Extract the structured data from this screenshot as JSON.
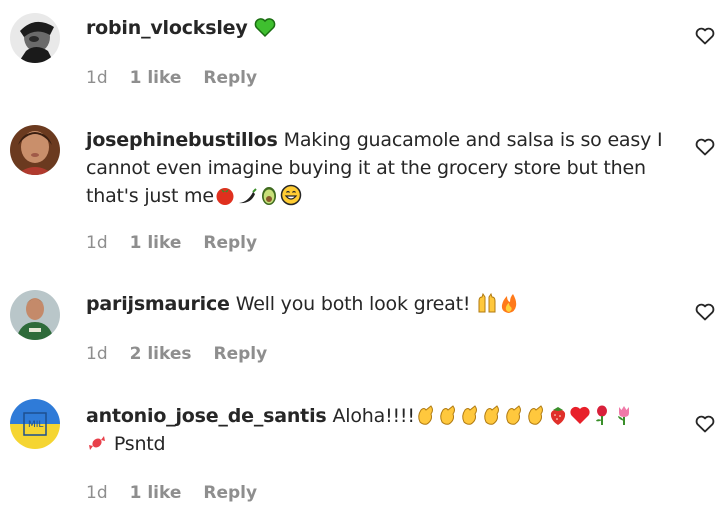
{
  "comments": [
    {
      "username": "robin_vlocksley",
      "text": "",
      "emojis": [
        "green-heart"
      ],
      "time": "1d",
      "likes": "1 like",
      "reply": "Reply",
      "avatar": "dark-portrait"
    },
    {
      "username": "josephinebustillos",
      "text": "Making guacamole and salsa is so easy I cannot even imagine buying it at the grocery store but then that's just me",
      "emojis": [
        "tomato",
        "hot-pepper",
        "avocado",
        "grinning-face"
      ],
      "time": "1d",
      "likes": "1 like",
      "reply": "Reply",
      "avatar": "woman-portrait"
    },
    {
      "username": "parijsmaurice",
      "text": "Well you both look great!",
      "emojis": [
        "raising-hands",
        "fire"
      ],
      "time": "1d",
      "likes": "2 likes",
      "reply": "Reply",
      "avatar": "man-green-shirt"
    },
    {
      "username": "antonio_jose_de_santis",
      "text": "Aloha!!!!",
      "text2": "Psntd",
      "emojis": [
        "clapping-hands",
        "clapping-hands",
        "clapping-hands",
        "clapping-hands",
        "clapping-hands",
        "clapping-hands",
        "strawberry",
        "red-heart",
        "rose",
        "tulip",
        "candy"
      ],
      "time": "1d",
      "likes": "1 like",
      "reply": "Reply",
      "avatar": "ukraine-flag-shirt"
    }
  ],
  "colors": {
    "text": "#262626",
    "meta": "#8e8e8e",
    "background": "#ffffff"
  },
  "icons": {
    "like": "heart-outline-icon"
  }
}
